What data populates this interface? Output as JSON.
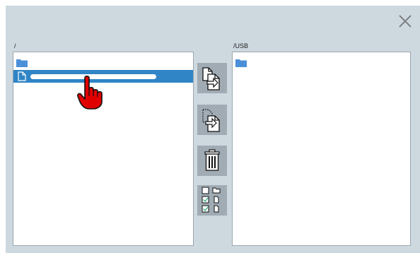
{
  "left_pane": {
    "path": "/",
    "items": [
      {
        "icon": "folder-icon"
      },
      {
        "icon": "file-icon",
        "selected": true
      }
    ]
  },
  "right_pane": {
    "path": "/USB",
    "items": [
      {
        "icon": "folder-icon"
      }
    ]
  },
  "toolbar": {
    "buttons": [
      {
        "name": "copy-button",
        "icon": "copy-file-icon"
      },
      {
        "name": "move-button",
        "icon": "move-file-icon"
      },
      {
        "name": "delete-button",
        "icon": "trash-icon"
      },
      {
        "name": "select-button",
        "icon": "select-checkbox-icon"
      }
    ]
  },
  "colors": {
    "background": "#cdd8df",
    "selection": "#2f85c6",
    "folder": "#4a90d9",
    "button": "#a0abb4",
    "cursor": "#e00000"
  },
  "cursor": {
    "icon": "pointing-hand-icon"
  }
}
